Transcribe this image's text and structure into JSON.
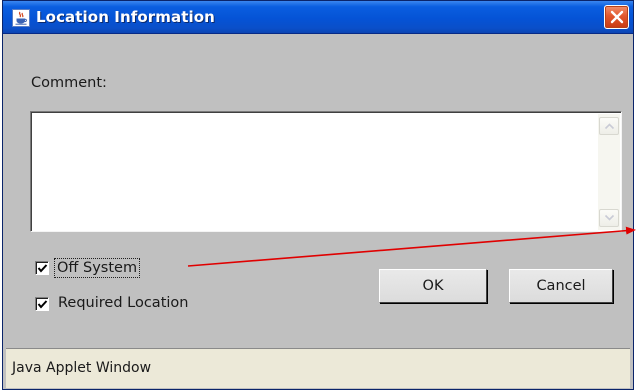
{
  "window": {
    "title": "Location Information",
    "icon": "java-cup-icon",
    "close_icon": "close-x-icon"
  },
  "form": {
    "comment_label": "Comment:",
    "comment_value": "",
    "off_system_label": "Off System",
    "off_system_checked": true,
    "required_location_label": "Required Location",
    "required_location_checked": true,
    "ok_label": "OK",
    "cancel_label": "Cancel"
  },
  "status_bar": {
    "text": "Java Applet Window"
  },
  "colors": {
    "titlebar": "#0553d6",
    "close_button": "#e2572d",
    "dialog_background": "#c0c0c0",
    "status_background": "#ece9d8",
    "annotation_arrow": "#e00000"
  }
}
